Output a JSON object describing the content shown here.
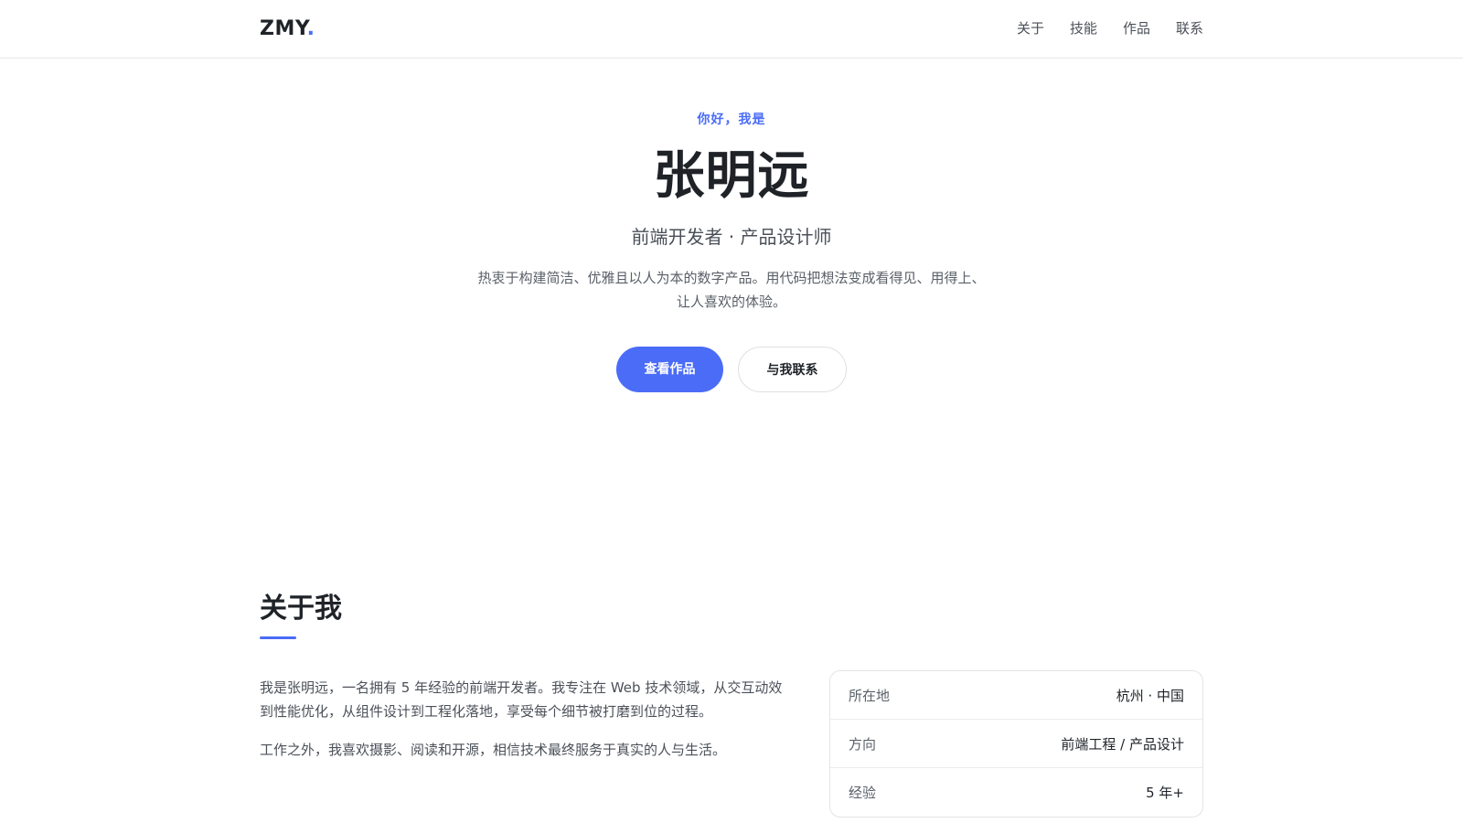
{
  "header": {
    "logo_text": "ZMY",
    "logo_dot": ".",
    "nav": [
      "关于",
      "技能",
      "作品",
      "联系"
    ]
  },
  "hero": {
    "greeting": "你好，我是",
    "name": "张明远",
    "role": "前端开发者 · 产品设计师",
    "description": "热衷于构建简洁、优雅且以人为本的数字产品。用代码把想法变成看得见、用得上、让人喜欢的体验。",
    "primary_button": "查看作品",
    "secondary_button": "与我联系"
  },
  "about": {
    "title": "关于我",
    "paragraphs": [
      "我是张明远，一名拥有 5 年经验的前端开发者。我专注在 Web 技术领域，从交互动效到性能优化，从组件设计到工程化落地，享受每个细节被打磨到位的过程。",
      "工作之外，我喜欢摄影、阅读和开源，相信技术最终服务于真实的人与生活。"
    ],
    "info": [
      {
        "label": "所在地",
        "value": "杭州 · 中国"
      },
      {
        "label": "方向",
        "value": "前端工程 / 产品设计"
      },
      {
        "label": "经验",
        "value": "5 年+"
      }
    ]
  },
  "colors": {
    "accent": "#4a6cf7",
    "text": "#1f2328",
    "muted": "#5a6068"
  }
}
